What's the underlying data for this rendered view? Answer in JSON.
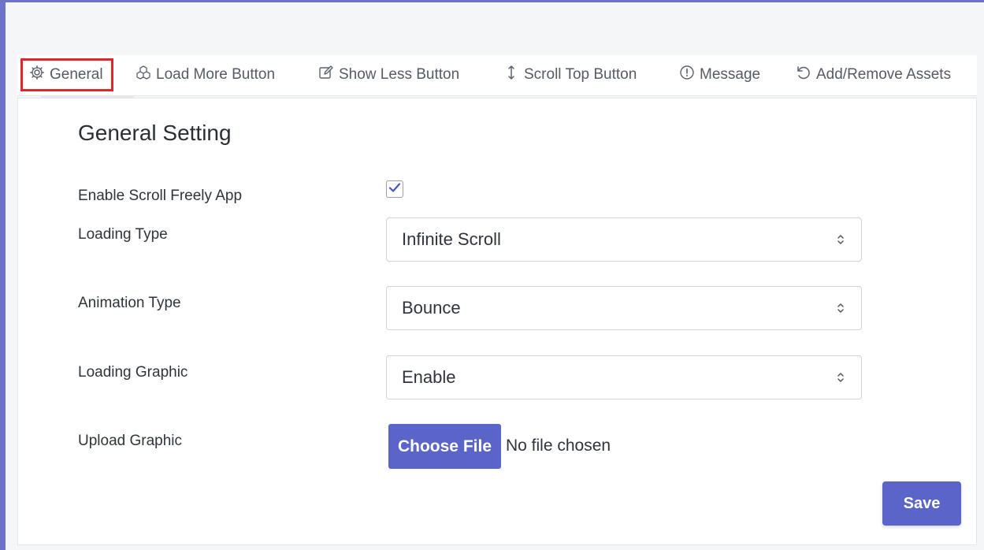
{
  "tabs": [
    {
      "label": "General",
      "icon": "gear-icon",
      "active": true
    },
    {
      "label": "Load More Button",
      "icon": "cubes-icon",
      "active": false
    },
    {
      "label": "Show Less Button",
      "icon": "edit-icon",
      "active": false
    },
    {
      "label": "Scroll Top Button",
      "icon": "arrows-vertical-icon",
      "active": false
    },
    {
      "label": "Message",
      "icon": "info-circle-icon",
      "active": false
    },
    {
      "label": "Add/Remove Assets",
      "icon": "undo-icon",
      "active": false
    }
  ],
  "panel": {
    "title": "General Setting",
    "enable_label": "Enable Scroll Freely App",
    "enable_checked": true,
    "loading_type_label": "Loading Type",
    "loading_type_value": "Infinite Scroll",
    "animation_type_label": "Animation Type",
    "animation_type_value": "Bounce",
    "loading_graphic_label": "Loading Graphic",
    "loading_graphic_value": "Enable",
    "upload_label": "Upload Graphic",
    "choose_file_label": "Choose File",
    "file_status": "No file chosen",
    "save_label": "Save"
  },
  "colors": {
    "accent": "#5b64c8",
    "frame": "#6c73c9",
    "active_tab_outline": "#e0252b"
  }
}
